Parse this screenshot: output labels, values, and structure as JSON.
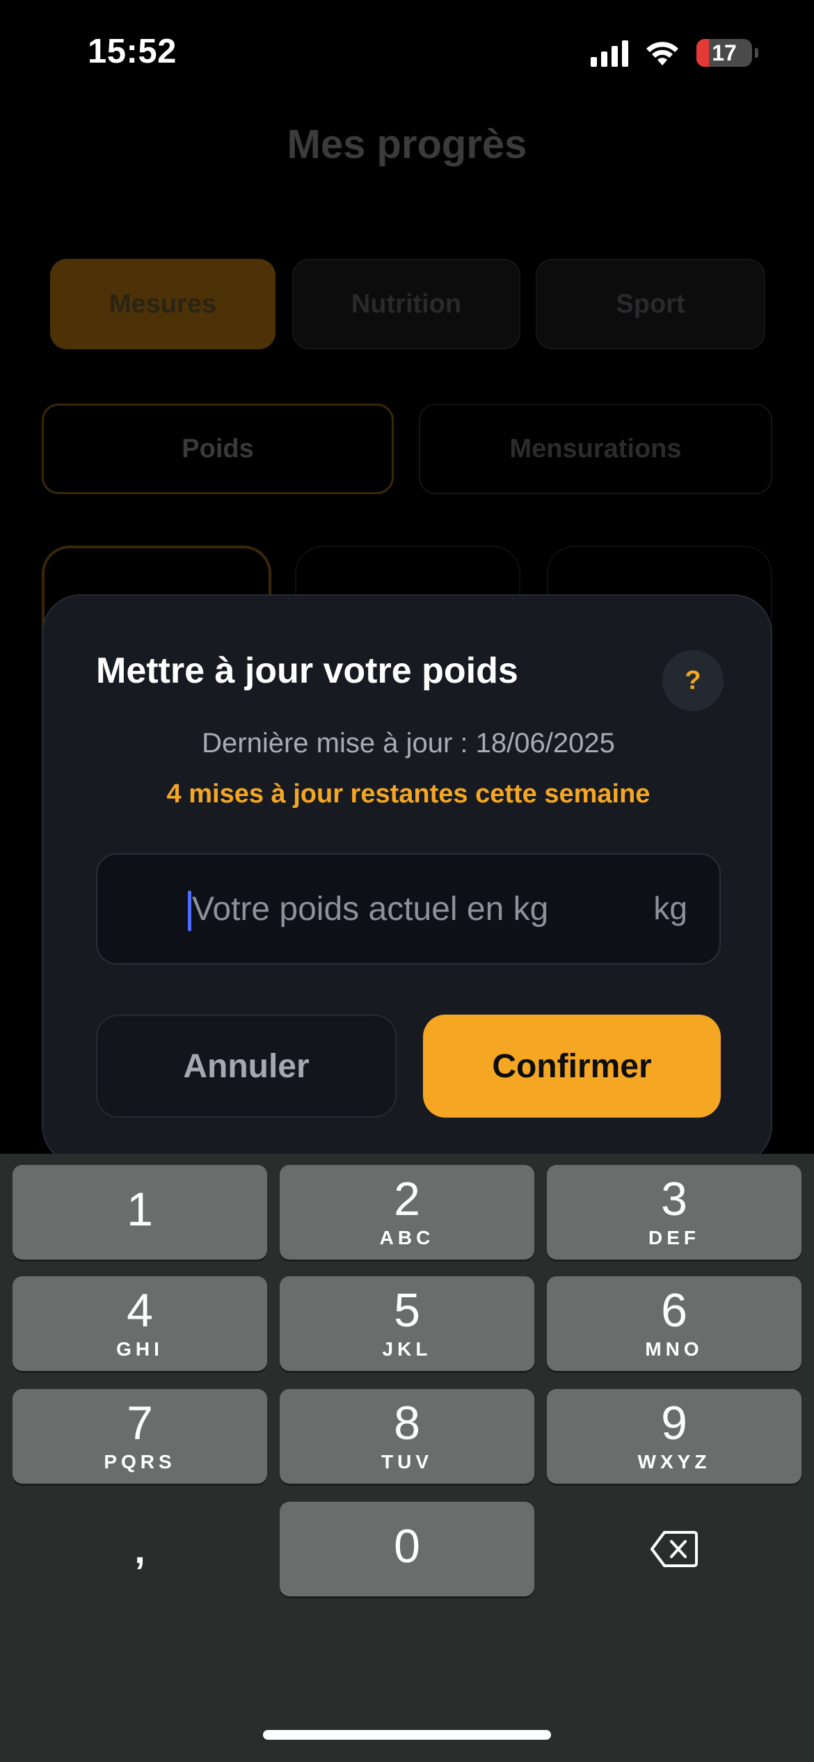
{
  "status_bar": {
    "time": "15:52",
    "battery_level": "17",
    "icons": [
      "signal-icon",
      "wifi-icon",
      "battery-icon"
    ]
  },
  "background": {
    "title": "Mes progrès",
    "tabs": [
      {
        "label": "Mesures",
        "active": true
      },
      {
        "label": "Nutrition",
        "active": false
      },
      {
        "label": "Sport",
        "active": false
      }
    ],
    "segments": [
      {
        "label": "Poids",
        "active": true
      },
      {
        "label": "Mensurations",
        "active": false
      }
    ]
  },
  "modal": {
    "title": "Mettre à jour votre poids",
    "help_label": "?",
    "last_update": "Dernière mise à jour : 18/06/2025",
    "remaining": "4 mises à jour restantes cette semaine",
    "input": {
      "placeholder": "Votre poids actuel en kg",
      "value": "",
      "unit": "kg"
    },
    "cancel_label": "Annuler",
    "confirm_label": "Confirmer"
  },
  "keyboard": {
    "keys": [
      {
        "digit": "1",
        "letters": ""
      },
      {
        "digit": "2",
        "letters": "ABC"
      },
      {
        "digit": "3",
        "letters": "DEF"
      },
      {
        "digit": "4",
        "letters": "GHI"
      },
      {
        "digit": "5",
        "letters": "JKL"
      },
      {
        "digit": "6",
        "letters": "MNO"
      },
      {
        "digit": "7",
        "letters": "PQRS"
      },
      {
        "digit": "8",
        "letters": "TUV"
      },
      {
        "digit": "9",
        "letters": "WXYZ"
      },
      {
        "digit": "0",
        "letters": ""
      }
    ],
    "decimal_label": ",",
    "delete_icon": "backspace-icon"
  },
  "colors": {
    "accent": "#f5a623",
    "modal_bg": "#171b21",
    "keyboard_bg": "#2b2c2c",
    "key_bg": "#6b6c6c"
  }
}
